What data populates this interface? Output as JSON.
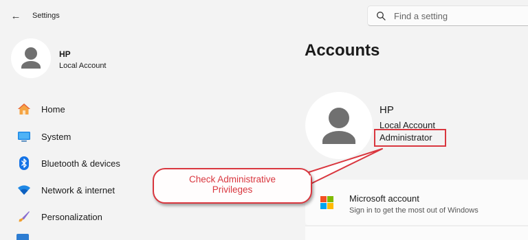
{
  "window": {
    "back_glyph": "←",
    "title": "Settings"
  },
  "search": {
    "placeholder": "Find a setting"
  },
  "user": {
    "name": "HP",
    "account_type": "Local Account"
  },
  "sidebar": {
    "items": [
      {
        "label": "Home",
        "icon": "home-icon"
      },
      {
        "label": "System",
        "icon": "system-icon"
      },
      {
        "label": "Bluetooth & devices",
        "icon": "bluetooth-icon"
      },
      {
        "label": "Network & internet",
        "icon": "wifi-icon"
      },
      {
        "label": "Personalization",
        "icon": "brush-icon"
      }
    ]
  },
  "main": {
    "title": "Accounts",
    "profile": {
      "name": "HP",
      "account_type": "Local Account",
      "role": "Administrator"
    },
    "microsoft_account": {
      "title": "Microsoft account",
      "subtitle": "Sign in to get the most out of Windows"
    }
  },
  "callout": {
    "line1": "Check Administrative",
    "line2": "Privileges"
  },
  "colors": {
    "accent": "#0067c0",
    "annotation_red": "#d9363e",
    "background": "#f3f3f3"
  }
}
